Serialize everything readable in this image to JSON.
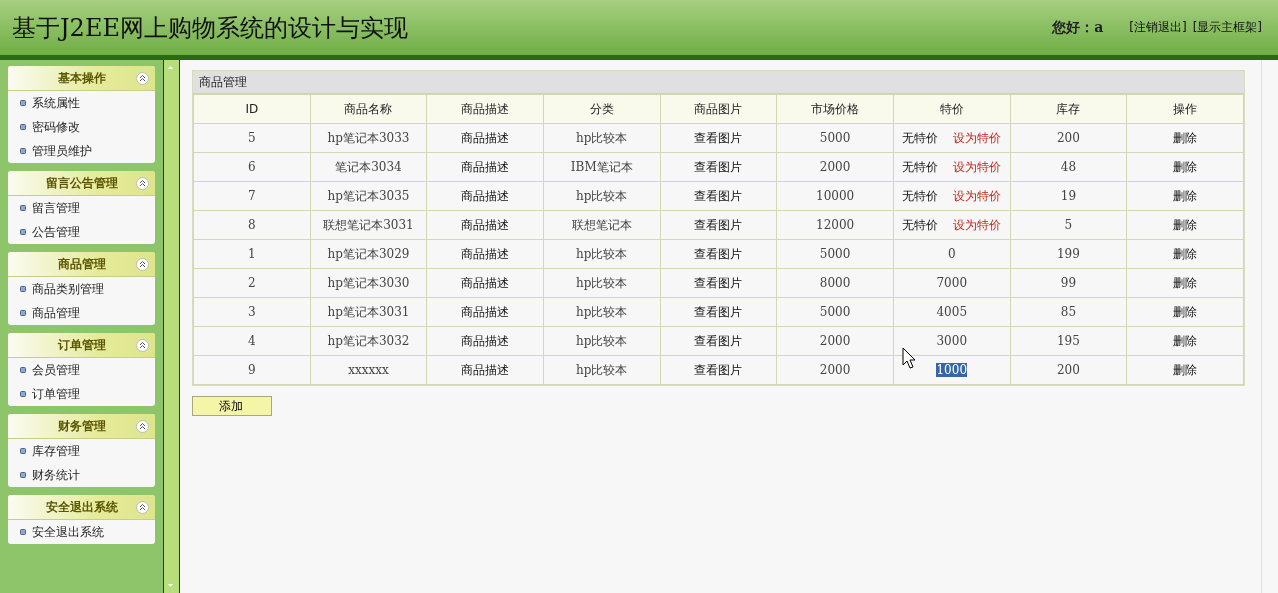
{
  "header": {
    "title": "基于J2EE网上购物系统的设计与实现",
    "greeting": "您好：a",
    "links": [
      "[注销退出]",
      "[显示主框架]"
    ]
  },
  "sidebar": {
    "groups": [
      {
        "title": "基本操作",
        "expanded": true,
        "items": [
          "系统属性",
          "密码修改",
          "管理员维护"
        ]
      },
      {
        "title": "留言公告管理",
        "expanded": true,
        "items": [
          "留言管理",
          "公告管理"
        ]
      },
      {
        "title": "商品管理",
        "expanded": true,
        "items": [
          "商品类别管理",
          "商品管理"
        ]
      },
      {
        "title": "订单管理",
        "expanded": true,
        "items": [
          "会员管理",
          "订单管理"
        ]
      },
      {
        "title": "财务管理",
        "expanded": true,
        "items": [
          "库存管理",
          "财务统计"
        ]
      },
      {
        "title": "安全退出系统",
        "expanded": true,
        "items": [
          "安全退出系统"
        ]
      }
    ]
  },
  "panel": {
    "title": "商品管理",
    "table": {
      "columns": [
        "ID",
        "商品名称",
        "商品描述",
        "分类",
        "商品图片",
        "市场价格",
        "特价",
        "库存",
        "操作"
      ],
      "rows": [
        {
          "id": "5",
          "name": "hp笔记本3033",
          "desc": "商品描述",
          "category": "hp比较本",
          "image": "查看图片",
          "price": "5000",
          "special": {
            "kind": "none",
            "label": "无特价",
            "action": "设为特价"
          },
          "stock": "200",
          "op": "删除"
        },
        {
          "id": "6",
          "name": "笔记本3034",
          "desc": "商品描述",
          "category": "IBM笔记本",
          "image": "查看图片",
          "price": "2000",
          "special": {
            "kind": "none",
            "label": "无特价",
            "action": "设为特价"
          },
          "stock": "48",
          "op": "删除"
        },
        {
          "id": "7",
          "name": "hp笔记本3035",
          "desc": "商品描述",
          "category": "hp比较本",
          "image": "查看图片",
          "price": "10000",
          "special": {
            "kind": "none",
            "label": "无特价",
            "action": "设为特价"
          },
          "stock": "19",
          "op": "删除"
        },
        {
          "id": "8",
          "name": "联想笔记本3031",
          "desc": "商品描述",
          "category": "联想笔记本",
          "image": "查看图片",
          "price": "12000",
          "special": {
            "kind": "none",
            "label": "无特价",
            "action": "设为特价"
          },
          "stock": "5",
          "op": "删除"
        },
        {
          "id": "1",
          "name": "hp笔记本3029",
          "desc": "商品描述",
          "category": "hp比较本",
          "image": "查看图片",
          "price": "5000",
          "special": {
            "kind": "price",
            "value": "0",
            "highlighted": false
          },
          "stock": "199",
          "op": "删除"
        },
        {
          "id": "2",
          "name": "hp笔记本3030",
          "desc": "商品描述",
          "category": "hp比较本",
          "image": "查看图片",
          "price": "8000",
          "special": {
            "kind": "price",
            "value": "7000",
            "highlighted": false
          },
          "stock": "99",
          "op": "删除"
        },
        {
          "id": "3",
          "name": "hp笔记本3031",
          "desc": "商品描述",
          "category": "hp比较本",
          "image": "查看图片",
          "price": "5000",
          "special": {
            "kind": "price",
            "value": "4005",
            "highlighted": false
          },
          "stock": "85",
          "op": "删除"
        },
        {
          "id": "4",
          "name": "hp笔记本3032",
          "desc": "商品描述",
          "category": "hp比较本",
          "image": "查看图片",
          "price": "2000",
          "special": {
            "kind": "price",
            "value": "3000",
            "highlighted": false
          },
          "stock": "195",
          "op": "删除"
        },
        {
          "id": "9",
          "name": "xxxxxx",
          "desc": "商品描述",
          "category": "hp比较本",
          "image": "查看图片",
          "price": "2000",
          "special": {
            "kind": "price",
            "value": "1000",
            "highlighted": true
          },
          "stock": "200",
          "op": "删除"
        }
      ]
    },
    "add_button": "添加"
  }
}
